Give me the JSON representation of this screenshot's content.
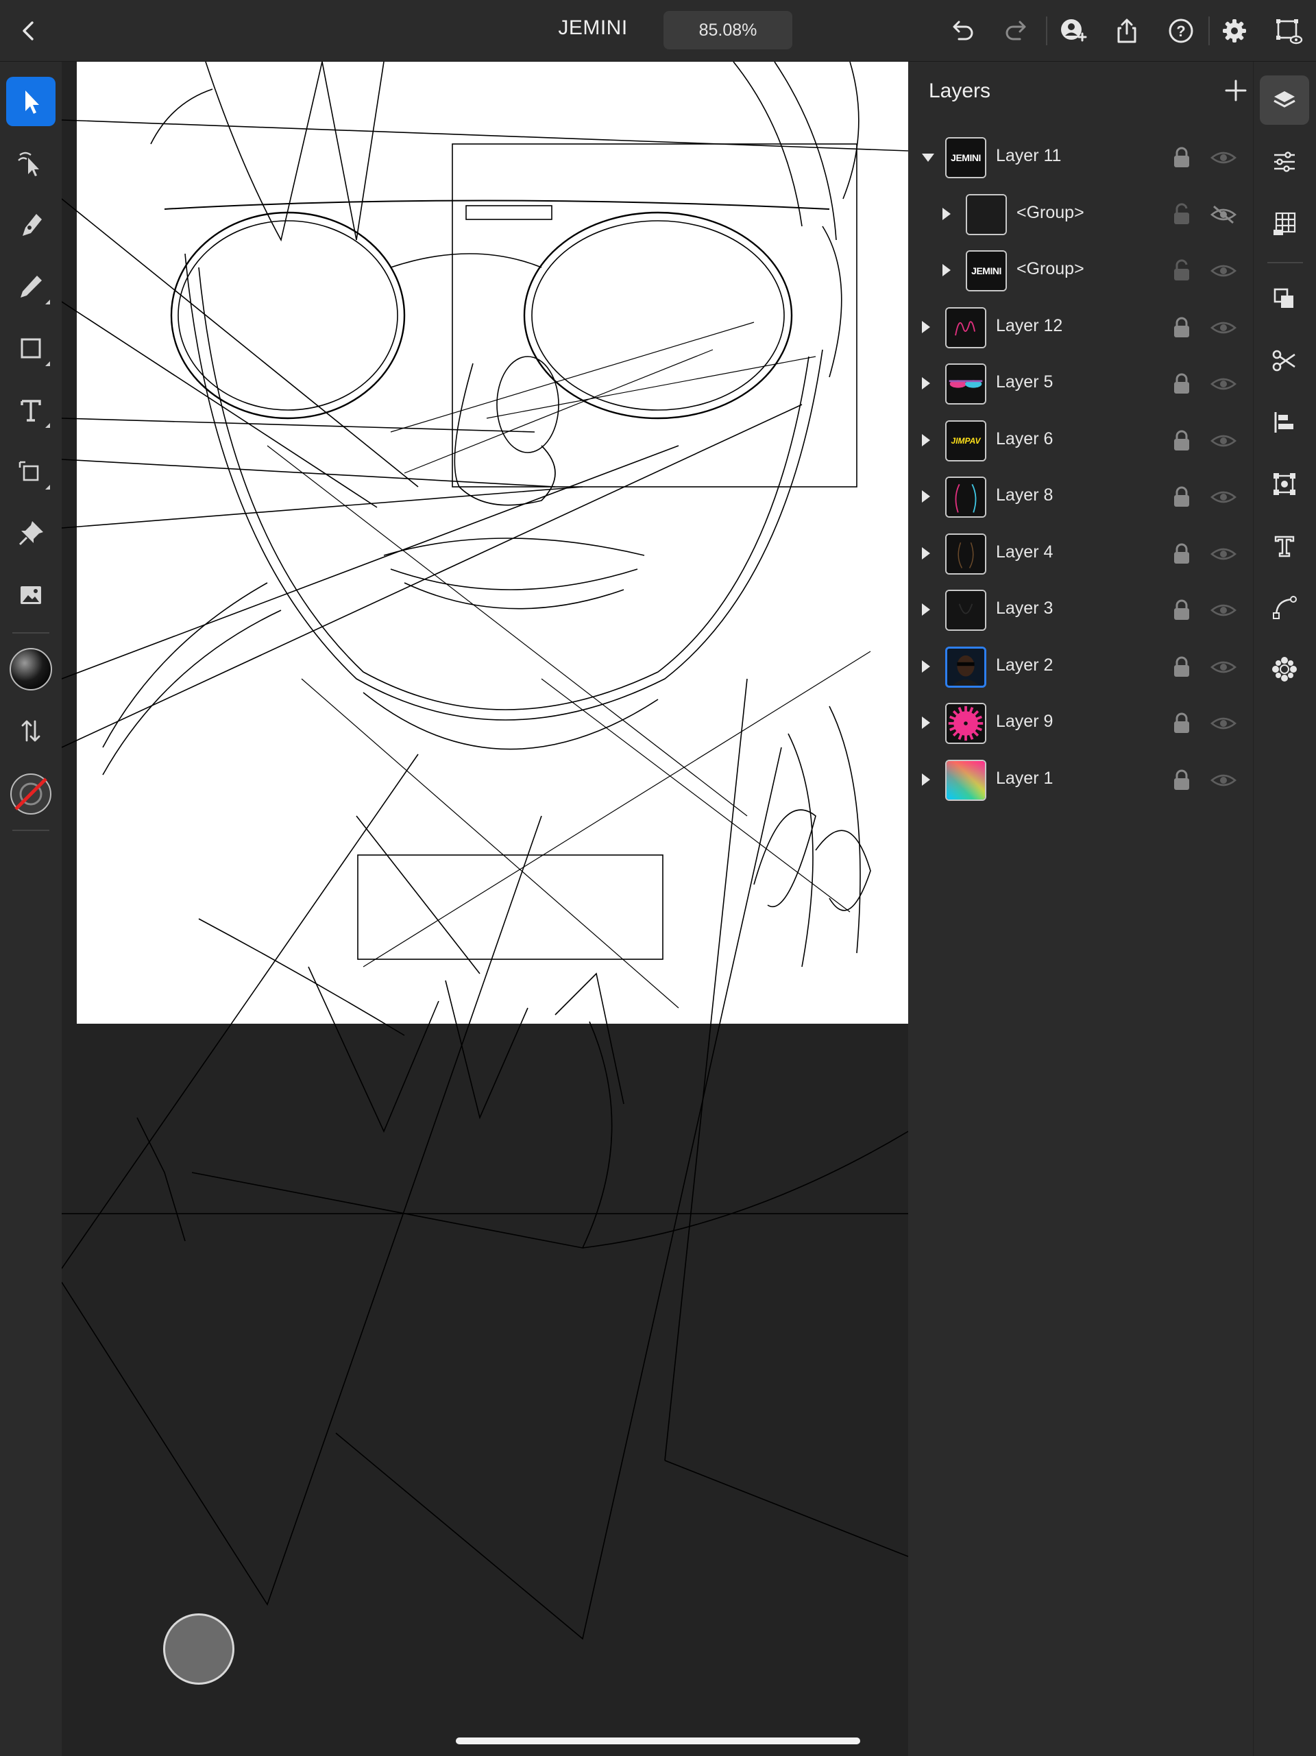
{
  "document": {
    "title": "JEMINI",
    "zoom": "85.08%"
  },
  "panel": {
    "title": "Layers",
    "layers": [
      {
        "name": "Layer 11",
        "expanded": true,
        "thumb": "jemini-text",
        "locked": true,
        "visible": true
      },
      {
        "name": "<Group>",
        "child": true,
        "thumb": "empty",
        "locked": false,
        "visible": false
      },
      {
        "name": "<Group>",
        "child": true,
        "thumb": "jemini-text",
        "locked": false,
        "visible": true
      },
      {
        "name": "Layer 12",
        "thumb": "signature-pink",
        "locked": true,
        "visible": true
      },
      {
        "name": "Layer 5",
        "thumb": "glasses-neon",
        "locked": true,
        "visible": true
      },
      {
        "name": "Layer 6",
        "thumb": "yellow-logo",
        "locked": true,
        "visible": true
      },
      {
        "name": "Layer 8",
        "thumb": "neon-lines",
        "locked": true,
        "visible": true
      },
      {
        "name": "Layer 4",
        "thumb": "dark-lines",
        "locked": true,
        "visible": true
      },
      {
        "name": "Layer 3",
        "thumb": "dark",
        "locked": true,
        "visible": true
      },
      {
        "name": "Layer 2",
        "thumb": "portrait",
        "locked": true,
        "visible": true,
        "selected": true
      },
      {
        "name": "Layer 9",
        "thumb": "pink-burst",
        "locked": true,
        "visible": true
      },
      {
        "name": "Layer 1",
        "thumb": "gradient",
        "locked": true,
        "visible": true
      }
    ]
  },
  "thumb_text": {
    "jemini": "JEMINI",
    "yellow": "JIMPAV"
  },
  "colors": {
    "accent": "#1473e6",
    "panel": "#2b2b2b",
    "canvas_bg": "#232323",
    "pink": "#f0308c"
  },
  "icons": {
    "topbar": [
      "back-chevron-icon",
      "undo-icon",
      "redo-icon",
      "invite-user-icon",
      "share-icon",
      "help-icon",
      "settings-gear-icon",
      "artboard-preview-icon"
    ],
    "tools": [
      "selection-arrow-icon",
      "direct-selection-icon",
      "pen-icon",
      "pencil-icon",
      "rectangle-icon",
      "text-tool-icon",
      "transform-icon",
      "pin-icon",
      "image-icon",
      "fill-swatch-icon",
      "swap-icon",
      "stroke-none-icon"
    ],
    "rail": [
      "layers-icon",
      "properties-icon",
      "grid-icon",
      "arrange-icon",
      "scissors-icon",
      "align-icon",
      "transform-box-icon",
      "type-icon",
      "path-icon",
      "repeat-icon"
    ]
  }
}
